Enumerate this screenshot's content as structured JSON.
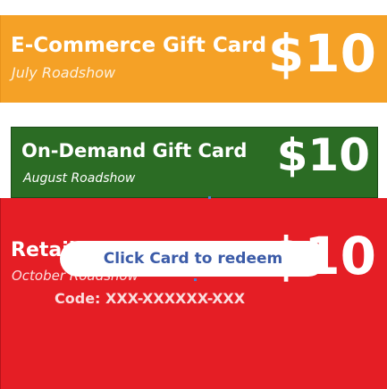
{
  "cards": {
    "ecommerce": {
      "title": "E-Commerce Gift Card",
      "subtitle": "July Roadshow",
      "amount": "$10",
      "color": "#f5a126"
    },
    "ondemand": {
      "title": "On-Demand Gift Card",
      "subtitle": "August Roadshow",
      "amount": "$10",
      "color": "#2b6c24"
    },
    "retail": {
      "title": "Retail  Gift Card",
      "subtitle": "October Roadshow",
      "amount": "$10",
      "color": "#e51e25"
    }
  },
  "redeem": {
    "label": "Click Card to redeem",
    "code_label": "Code: XXX-XXXXXX-XXX"
  }
}
